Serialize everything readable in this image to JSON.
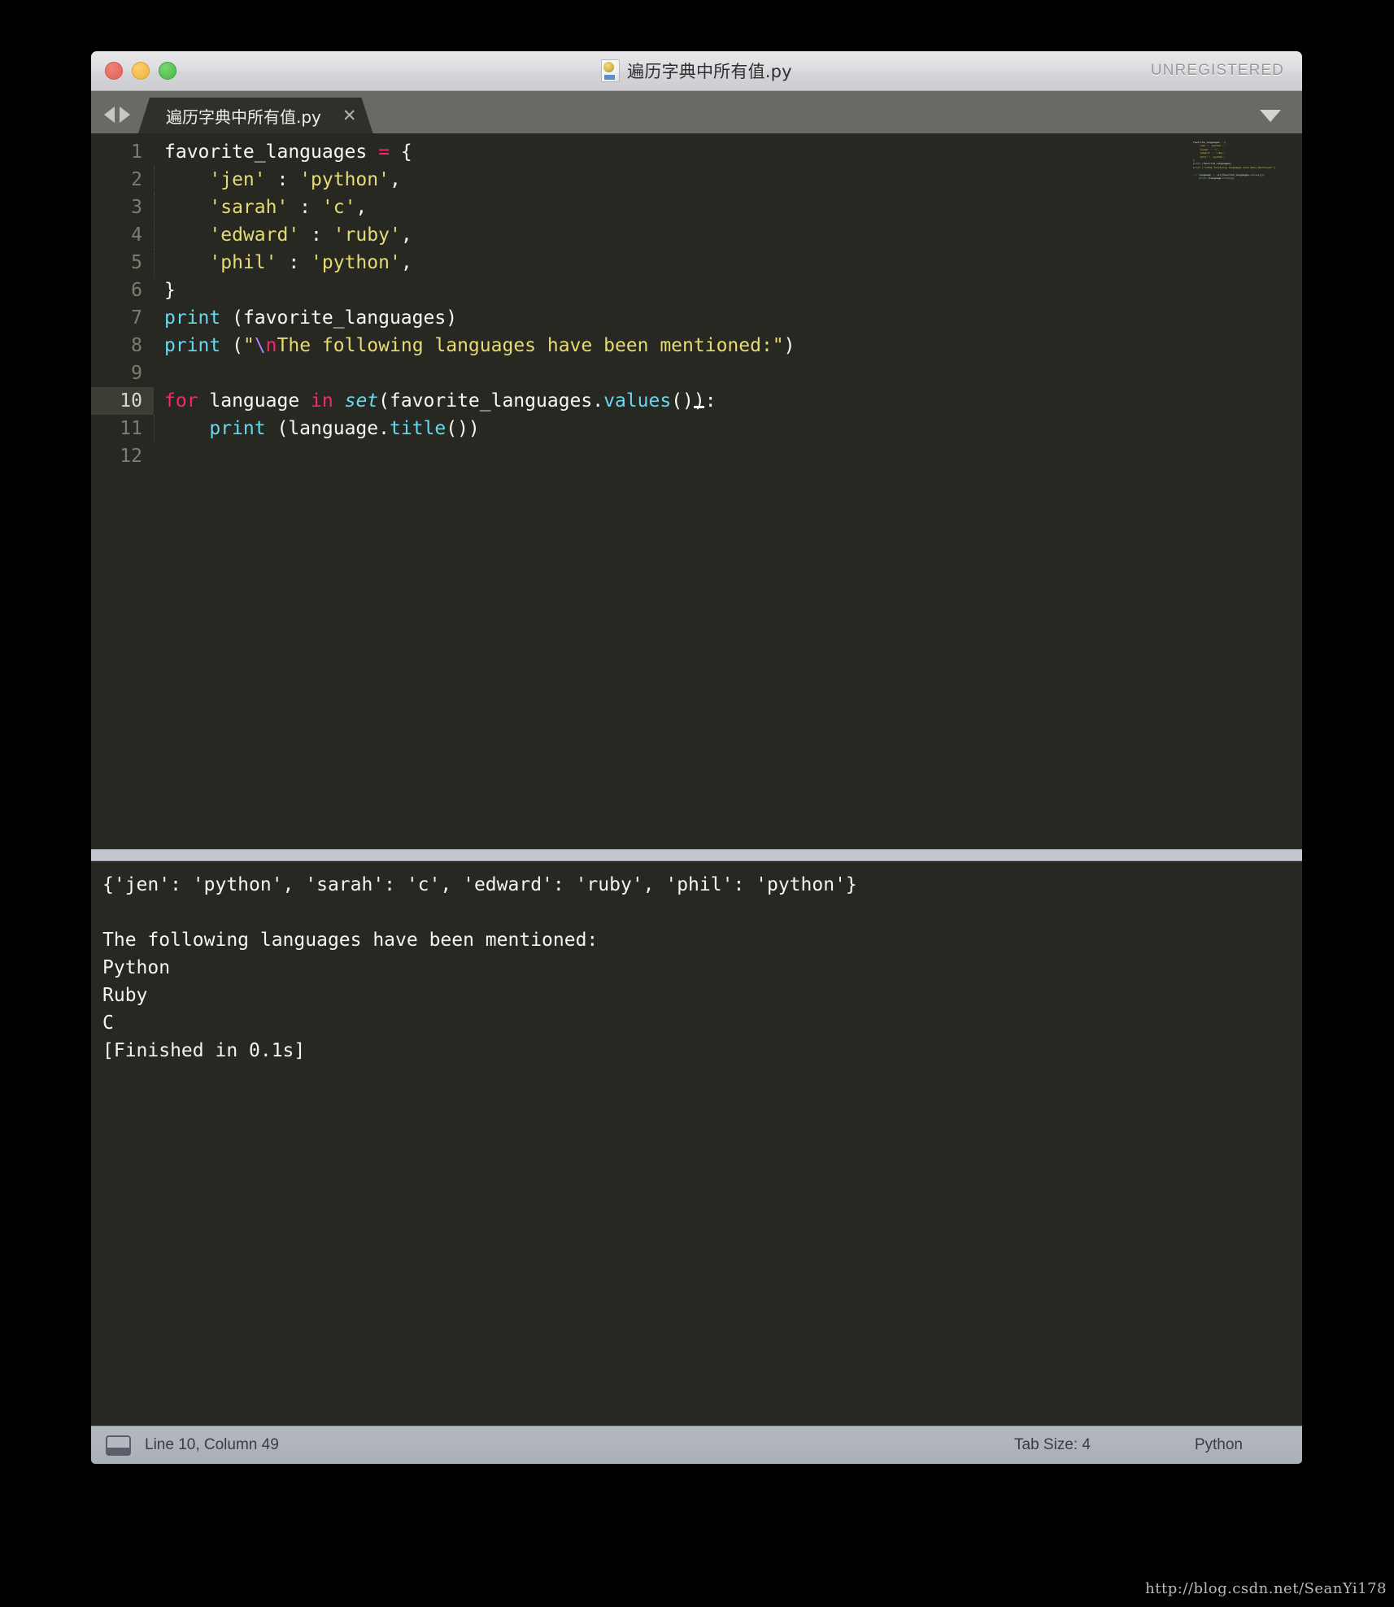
{
  "window": {
    "title": "遍历字典中所有值.py",
    "license_badge": "UNREGISTERED",
    "file_icon": "python-file-icon"
  },
  "tabbar": {
    "prev_icon": "arrow-left-icon",
    "next_icon": "arrow-right-icon",
    "dropdown_icon": "chevron-down-icon",
    "tabs": [
      {
        "label": "遍历字典中所有值.py",
        "close_label": "✕",
        "active": true
      }
    ]
  },
  "editor": {
    "active_line": 10,
    "cursor": {
      "line": 10,
      "column": 49
    },
    "lines": [
      {
        "n": "1",
        "text": "favorite_languages = {"
      },
      {
        "n": "2",
        "text": "    'jen' : 'python',"
      },
      {
        "n": "3",
        "text": "    'sarah' : 'c',"
      },
      {
        "n": "4",
        "text": "    'edward' : 'ruby',"
      },
      {
        "n": "5",
        "text": "    'phil' : 'python',"
      },
      {
        "n": "6",
        "text": "}"
      },
      {
        "n": "7",
        "text": "print (favorite_languages)"
      },
      {
        "n": "8",
        "text": "print (\"\\nThe following languages have been mentioned:\")"
      },
      {
        "n": "9",
        "text": ""
      },
      {
        "n": "10",
        "text": "for language in set(favorite_languages.values()):"
      },
      {
        "n": "11",
        "text": "    print (language.title())"
      },
      {
        "n": "12",
        "text": ""
      }
    ]
  },
  "output": {
    "lines": [
      "{'jen': 'python', 'sarah': 'c', 'edward': 'ruby', 'phil': 'python'}",
      "",
      "The following languages have been mentioned:",
      "Python",
      "Ruby",
      "C",
      "[Finished in 0.1s]"
    ]
  },
  "statusbar": {
    "console_icon": "console-toggle-icon",
    "position": "Line 10, Column 49",
    "tab_size": "Tab Size: 4",
    "language": "Python"
  },
  "watermark": "http://blog.csdn.net/SeanYi178",
  "colors": {
    "editor_bg": "#272822",
    "keyword": "#f92672",
    "string": "#e6db74",
    "function": "#66d9ef",
    "escape": "#ae81ff",
    "plain": "#f8f8f2",
    "gutter_text": "#7c7d72",
    "active_line": "#3d3d35",
    "titlebar": "#dddce0",
    "tabbar": "#6a6a64",
    "statusbar": "#b0b4bc"
  }
}
